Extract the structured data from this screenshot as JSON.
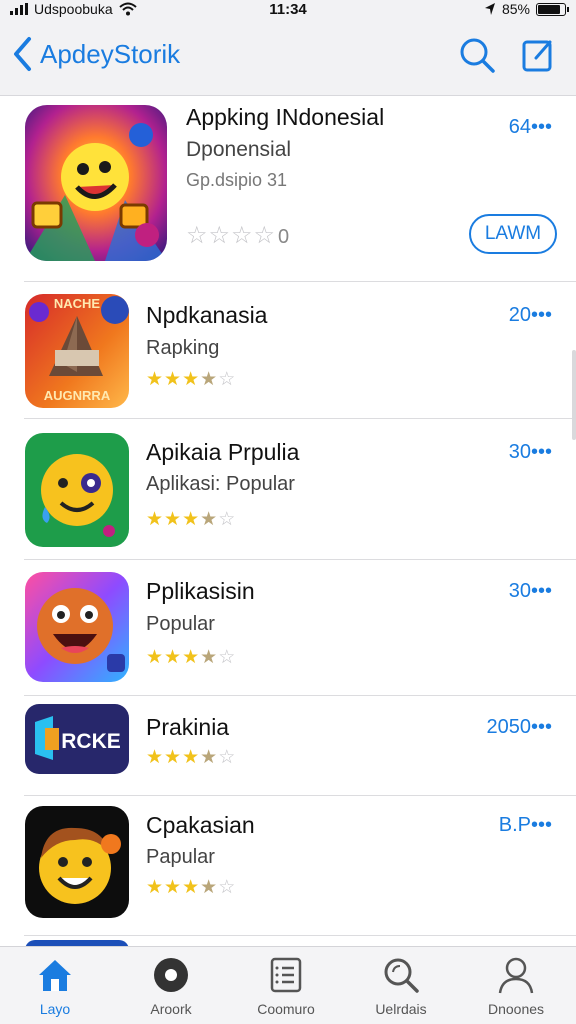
{
  "status_bar": {
    "carrier": "Udspoobuka",
    "time": "11:34",
    "battery": "85%",
    "battery_level": 0.85
  },
  "nav": {
    "back_label": "ApdeyStorik",
    "search_icon": "search-icon",
    "compose_icon": "compose-icon"
  },
  "apps": [
    {
      "name": "Appking INdonesial",
      "subtitle": "Dponensial",
      "meta": "Gp.dsipio 31",
      "price": "64•••",
      "rating_count": "0",
      "stars": 0,
      "button": "LAWM"
    },
    {
      "name": "Npdkanasia",
      "subtitle": "Rapking",
      "price": "20•••",
      "stars": 3.5,
      "icon_text_top": "NACHE",
      "icon_text_bottom": "AUGNRRA"
    },
    {
      "name": "Apikaia Prpulia",
      "subtitle": "Aplikasi: Popular",
      "price": "30•••",
      "stars": 3.5
    },
    {
      "name": "Pplikasisin",
      "subtitle": "Popular",
      "price": "30•••",
      "stars": 3
    },
    {
      "name": "Prakinia",
      "price": "2050•••",
      "stars": 3.5,
      "icon_text": "RCKE"
    },
    {
      "name": "Cpakasian",
      "subtitle": "Papular",
      "price": "B.P•••",
      "stars": 3.5
    }
  ],
  "tabs": [
    {
      "label": "Layo",
      "icon": "home-icon",
      "active": true
    },
    {
      "label": "Aroork",
      "icon": "record-icon",
      "active": false
    },
    {
      "label": "Coomuro",
      "icon": "list-icon",
      "active": false
    },
    {
      "label": "Uelrdais",
      "icon": "search-icon",
      "active": false
    },
    {
      "label": "Dnoones",
      "icon": "person-icon",
      "active": false
    }
  ],
  "colors": {
    "accent": "#1a7ce0",
    "star": "#f1c21b"
  }
}
